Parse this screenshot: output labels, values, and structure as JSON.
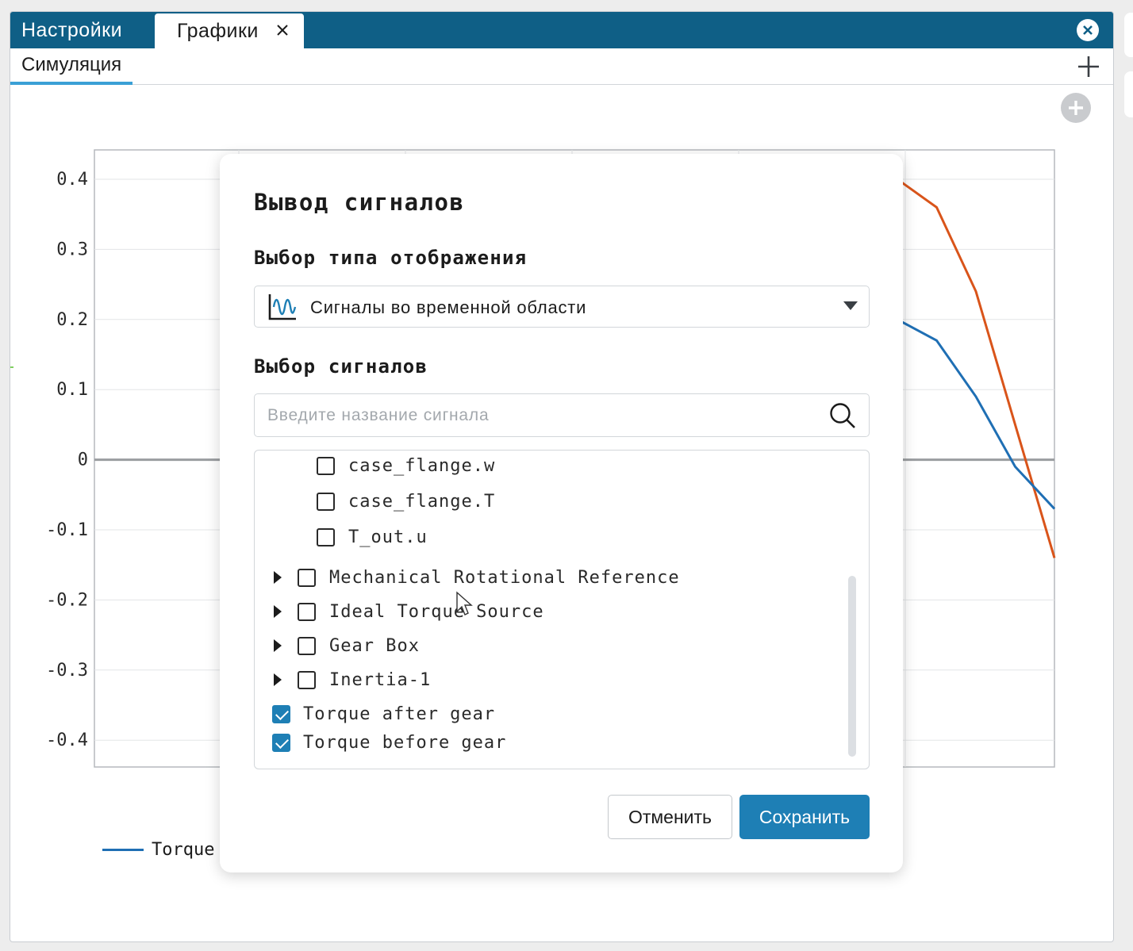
{
  "tabs": {
    "settings": "Настройки",
    "graphs": "Графики",
    "subtab": "Симуляция"
  },
  "chart_data": {
    "type": "line",
    "yticks": [
      "0.4",
      "0.3",
      "0.2",
      "0.1",
      "0",
      "-0.1",
      "-0.2",
      "-0.3",
      "-0.4"
    ],
    "ylim": [
      -0.44,
      0.44
    ],
    "grid": true,
    "legend": [
      {
        "label": "Torque",
        "color": "#1f6fb4"
      }
    ],
    "series": [
      {
        "color": "#d9541a",
        "points": [
          [
            0,
            0.4
          ],
          [
            0.25,
            0.36
          ],
          [
            0.5,
            0.24
          ],
          [
            0.75,
            0.05
          ],
          [
            1.0,
            -0.14
          ]
        ]
      },
      {
        "color": "#1f6fb4",
        "points": [
          [
            0,
            0.2
          ],
          [
            0.25,
            0.17
          ],
          [
            0.5,
            0.09
          ],
          [
            0.75,
            -0.01
          ],
          [
            1.0,
            -0.07
          ]
        ]
      }
    ]
  },
  "dialog": {
    "title": "Вывод сигналов",
    "display_type_label": "Выбор типа отображения",
    "display_type_value": "Сигналы во временной области",
    "display_type_icon": "time-signal-icon",
    "signals_label": "Выбор сигналов",
    "search_placeholder": "Введите название сигнала",
    "tree": [
      {
        "label": "case_flange.w",
        "level": 2,
        "checked": false,
        "expandable": false
      },
      {
        "label": "case_flange.T",
        "level": 2,
        "checked": false,
        "expandable": false
      },
      {
        "label": "T_out.u",
        "level": 2,
        "checked": false,
        "expandable": false
      },
      {
        "label": "Mechanical Rotational Reference",
        "level": 1,
        "checked": false,
        "expandable": true
      },
      {
        "label": "Ideal Torque Source",
        "level": 1,
        "checked": false,
        "expandable": true
      },
      {
        "label": "Gear Box",
        "level": 1,
        "checked": false,
        "expandable": true
      },
      {
        "label": "Inertia-1",
        "level": 1,
        "checked": false,
        "expandable": true
      },
      {
        "label": "Torque after gear",
        "level": 0,
        "checked": true,
        "expandable": false
      },
      {
        "label": "Torque before gear",
        "level": 0,
        "checked": true,
        "expandable": false
      }
    ],
    "cancel_label": "Отменить",
    "save_label": "Сохранить"
  }
}
